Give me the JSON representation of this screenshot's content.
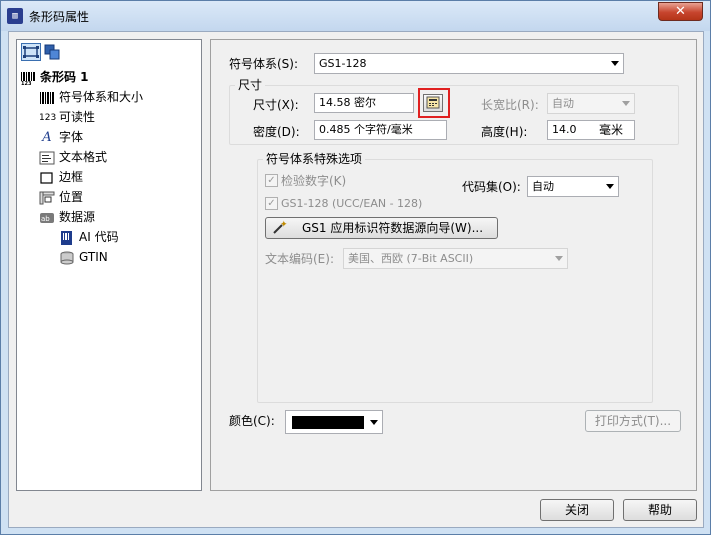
{
  "window": {
    "title": "条形码属性",
    "close_glyph": "✕"
  },
  "tree": {
    "items": [
      {
        "label": "条形码 1",
        "icon": "barcode-icon"
      },
      {
        "label": "符号体系和大小",
        "icon": "barcode-bars-icon"
      },
      {
        "label": "可读性",
        "icon": "readable-123-icon"
      },
      {
        "label": "字体",
        "icon": "font-icon"
      },
      {
        "label": "文本格式",
        "icon": "text-format-icon"
      },
      {
        "label": "边框",
        "icon": "border-icon"
      },
      {
        "label": "位置",
        "icon": "position-icon"
      },
      {
        "label": "数据源",
        "icon": "datasource-icon"
      },
      {
        "label": "AI 代码",
        "icon": "ai-code-icon"
      },
      {
        "label": "GTIN",
        "icon": "database-icon"
      }
    ]
  },
  "symbology": {
    "label": "符号体系(S):",
    "value": "GS1-128"
  },
  "size_group": {
    "title": "尺寸",
    "size_label": "尺寸(X):",
    "size_value": "14.58 密尔",
    "aspect_label": "长宽比(R):",
    "aspect_value": "自动",
    "density_label": "密度(D):",
    "density_value": "0.485 个字符/毫米",
    "height_label": "高度(H):",
    "height_value": "14.0",
    "height_unit": "毫米"
  },
  "special_group": {
    "title": "符号体系特殊选项",
    "check_digit_label": "检验数字(K)",
    "gs1_label": "GS1-128 (UCC/EAN - 128)",
    "codeset_label": "代码集(O):",
    "codeset_value": "自动",
    "wizard_label": "GS1 应用标识符数据源向导(W)...",
    "encoding_label": "文本编码(E):",
    "encoding_value": "美国、西欧 (7-Bit ASCII)"
  },
  "color": {
    "label": "颜色(C):",
    "value": "#000000"
  },
  "print_method_label": "打印方式(T)...",
  "buttons": {
    "close": "关闭",
    "help": "帮助"
  },
  "colors": {
    "accent": "#3a6fb0",
    "highlight": "#e02020",
    "titlebar": "#c3d7ee"
  }
}
